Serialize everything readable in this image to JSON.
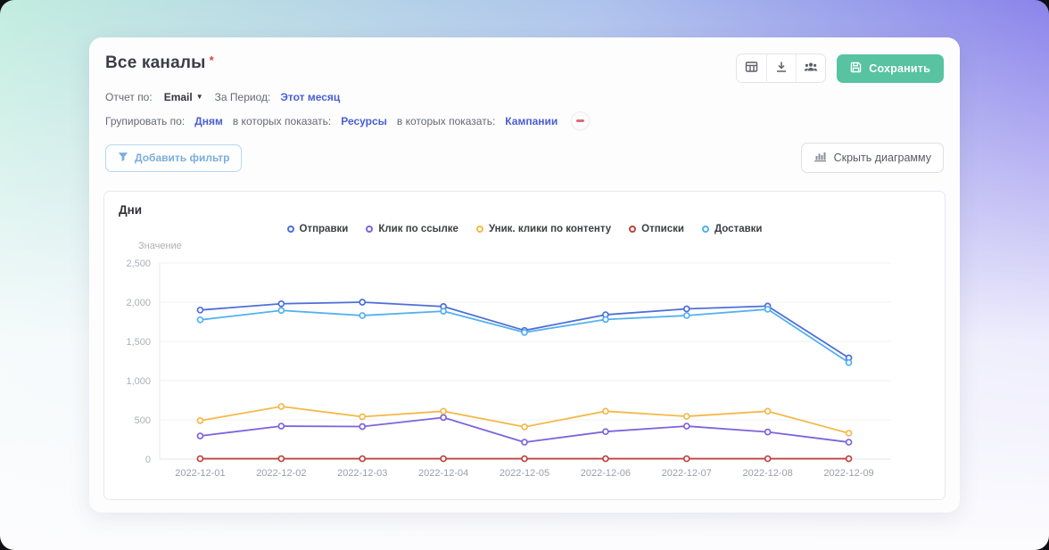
{
  "header": {
    "title": "Все каналы",
    "required_mark": "*",
    "toolbar": {
      "icons": [
        "table-icon",
        "download-icon",
        "users-icon"
      ],
      "save_label": "Сохранить"
    }
  },
  "filters": {
    "report_by_label": "Отчет по:",
    "report_by_value": "Email",
    "period_label": "За Период:",
    "period_value": "Этот месяц",
    "group_by_label": "Групировать по:",
    "group_by_value": "Дням",
    "show_in_label": "в которых показать:",
    "show_in_value_1": "Ресурсы",
    "show_in_value_2": "Кампании"
  },
  "actions": {
    "add_filter_label": "Добавить фильтр",
    "hide_chart_label": "Скрыть диаграмму"
  },
  "panel": {
    "title": "Дни"
  },
  "colors": {
    "accent_green": "#57c3a1",
    "link_blue": "#4a5ed2",
    "filter_blue": "#7aadda",
    "danger_red": "#dd6b6e"
  },
  "chart_data": {
    "type": "line",
    "title": "Дни",
    "xlabel": "",
    "ylabel": "Значение",
    "ylim": [
      0,
      2500
    ],
    "ytick_step": 500,
    "yticks": [
      "0",
      "500",
      "1,000",
      "1,500",
      "2,000",
      "2,500"
    ],
    "grid": true,
    "legend_position": "top-center",
    "categories": [
      "2022-12-01",
      "2022-12-02",
      "2022-12-03",
      "2022-12-04",
      "2022-12-05",
      "2022-12-06",
      "2022-12-07",
      "2022-12-08",
      "2022-12-09"
    ],
    "series": [
      {
        "name": "Отправки",
        "color": "#4e6fd6",
        "values": [
          1900,
          1980,
          2000,
          1945,
          1640,
          1840,
          1915,
          1950,
          1290
        ]
      },
      {
        "name": "Клик по ссылке",
        "color": "#7d64dd",
        "values": [
          295,
          420,
          415,
          530,
          215,
          350,
          420,
          345,
          215
        ]
      },
      {
        "name": "Уник. клики по контенту",
        "color": "#f3b94a",
        "values": [
          490,
          670,
          540,
          610,
          410,
          610,
          545,
          610,
          330
        ]
      },
      {
        "name": "Отписки",
        "color": "#bf4240",
        "values": [
          5,
          5,
          5,
          5,
          5,
          5,
          5,
          5,
          5
        ]
      },
      {
        "name": "Доставки",
        "color": "#53b1ed",
        "values": [
          1775,
          1895,
          1830,
          1885,
          1615,
          1780,
          1830,
          1910,
          1230
        ]
      }
    ]
  }
}
